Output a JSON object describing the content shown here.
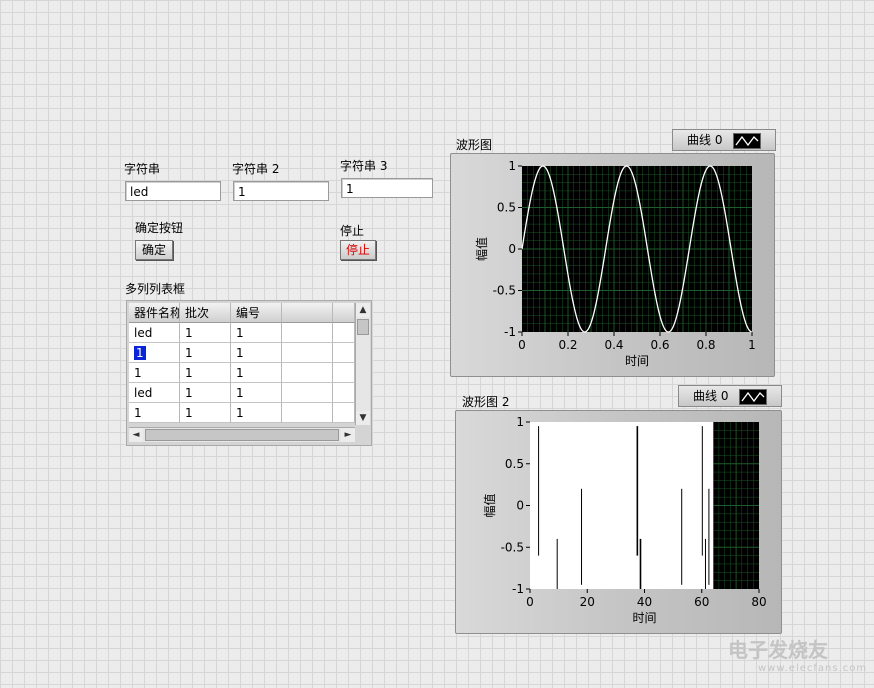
{
  "controls": {
    "str1": {
      "label": "字符串",
      "value": "led"
    },
    "str2": {
      "label": "字符串 2",
      "value": "1"
    },
    "str3": {
      "label": "字符串 3",
      "value": "1"
    },
    "confirm": {
      "label": "确定按钮",
      "button": "确定"
    },
    "stop": {
      "label": "停止",
      "button": "停止"
    }
  },
  "listbox": {
    "label": "多列列表框",
    "headers": [
      "器件名称",
      "批次",
      "编号",
      "",
      ""
    ],
    "rows": [
      [
        "led",
        "1",
        "1",
        "",
        ""
      ],
      [
        "1",
        "1",
        "1",
        "",
        ""
      ],
      [
        "1",
        "1",
        "1",
        "",
        ""
      ],
      [
        "led",
        "1",
        "1",
        "",
        ""
      ],
      [
        "1",
        "1",
        "1",
        "",
        ""
      ]
    ],
    "scroll_up": "▲",
    "scroll_down": "▼",
    "scroll_left": "◄",
    "scroll_right": "►"
  },
  "graph1": {
    "label": "波形图",
    "legend": "曲线 0"
  },
  "graph2": {
    "label": "波形图 2",
    "legend": "曲线 0"
  },
  "chart_data": [
    {
      "type": "line",
      "title": "波形图",
      "xlabel": "时间",
      "ylabel": "幅值",
      "xlim": [
        0,
        1
      ],
      "ylim": [
        -1,
        1
      ],
      "xticks": [
        "0",
        "0.2",
        "0.4",
        "0.6",
        "0.8",
        "1"
      ],
      "yticks": [
        "1",
        "0.5",
        "0",
        "-0.5",
        "-1"
      ],
      "grid": true,
      "legend_position": "top-right",
      "series": [
        {
          "name": "曲线 0",
          "function": "sine",
          "cycles": 2.75,
          "amplitude": 1,
          "color": "#ffffff"
        }
      ],
      "colors": {
        "plot_bg": "#000000",
        "grid": "#1d5c2a",
        "curve": "#ffffff"
      }
    },
    {
      "type": "line",
      "title": "波形图 2",
      "xlabel": "时间",
      "ylabel": "幅值",
      "xlim": [
        0,
        80
      ],
      "ylim": [
        -1,
        1
      ],
      "xticks": [
        "0",
        "20",
        "40",
        "60",
        "80"
      ],
      "yticks": [
        "1",
        "0.5",
        "0",
        "-0.5",
        "-1"
      ],
      "grid": true,
      "legend_position": "top-right",
      "series": [
        {
          "name": "曲线 0",
          "function": "dense oscillation",
          "x_extent": [
            0,
            64
          ],
          "amplitude": 1,
          "color": "#ffffff"
        }
      ],
      "colors": {
        "plot_bg": "#000000",
        "grid": "#1d5c2a",
        "curve": "#ffffff"
      }
    }
  ],
  "watermark": {
    "title": "电子发烧友",
    "url": "www.elecfans.com"
  }
}
